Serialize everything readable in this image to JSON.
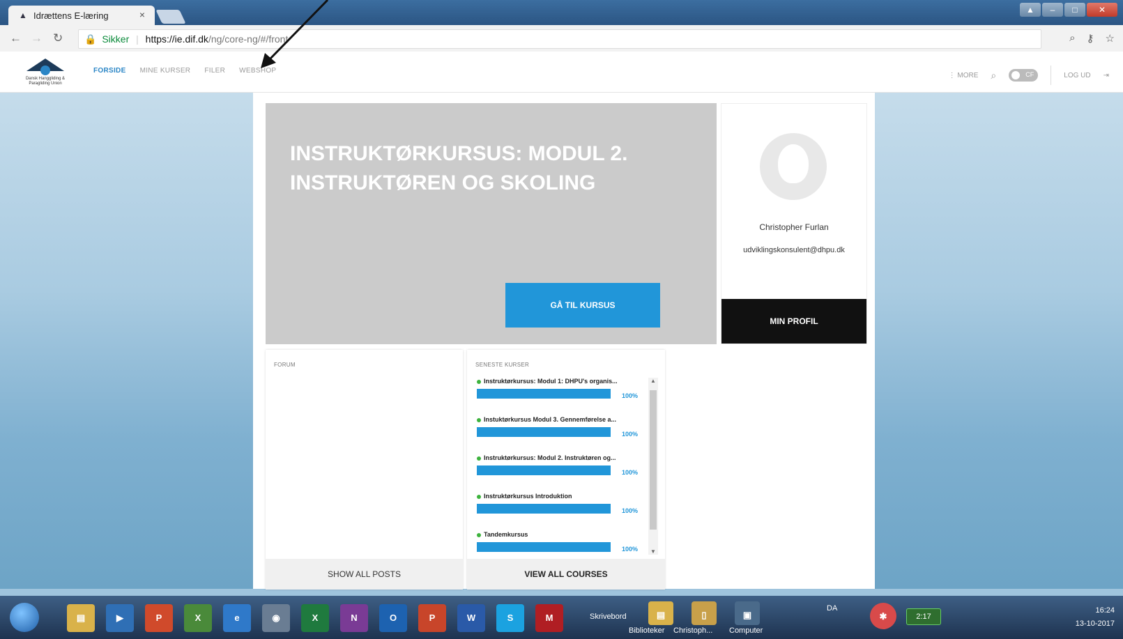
{
  "browser": {
    "tab_title": "Idrættens E-læring",
    "tab_close": "×",
    "secure_label": "Sikker",
    "url_host": "https://ie.dif.dk",
    "url_path": "/ng/core-ng/#/front"
  },
  "nav": {
    "logo_text": "Dansk Hanggliding & Paragliding Union",
    "items": [
      "FORSIDE",
      "MINE KURSER",
      "FILER",
      "WEBSHOP"
    ],
    "more": "⋮ MORE",
    "toggle_label": "CF",
    "logout": "LOG UD"
  },
  "hero": {
    "title": "INSTRUKTØRKURSUS: MODUL 2. INSTRUKTØREN OG SKOLING",
    "button": "GÅ TIL KURSUS"
  },
  "profile": {
    "name": "Christopher Furlan",
    "email": "udviklingskonsulent@dhpu.dk",
    "button": "MIN PROFIL"
  },
  "forum": {
    "title": "FORUM",
    "footer": "SHOW ALL POSTS"
  },
  "recent_courses": {
    "title": "SENESTE KURSER",
    "footer": "VIEW ALL COURSES",
    "items": [
      {
        "name": "Instruktørkursus: Modul 1: DHPU's organis...",
        "progress": 100,
        "pct": "100%"
      },
      {
        "name": "Instuktørkursus Modul 3. Gennemførelse a...",
        "progress": 100,
        "pct": "100%"
      },
      {
        "name": "Instruktørkursus: Modul 2. Instruktøren og...",
        "progress": 100,
        "pct": "100%"
      },
      {
        "name": "Instruktørkursus Introduktion",
        "progress": 100,
        "pct": "100%"
      },
      {
        "name": "Tandemkursus",
        "progress": 100,
        "pct": "100%"
      }
    ]
  },
  "taskbar": {
    "skrivebord": "Skrivebord",
    "biblioteker": "Biblioteker",
    "christoph": "Christoph...",
    "computer": "Computer",
    "lang": "DA",
    "battery": "2:17",
    "time": "16:24",
    "date": "13-10-2017"
  },
  "colors": {
    "accent": "#2196d9",
    "profile_button": "#111111",
    "hero_bg": "#cbcbcb",
    "progress_dot": "#3db33d"
  }
}
